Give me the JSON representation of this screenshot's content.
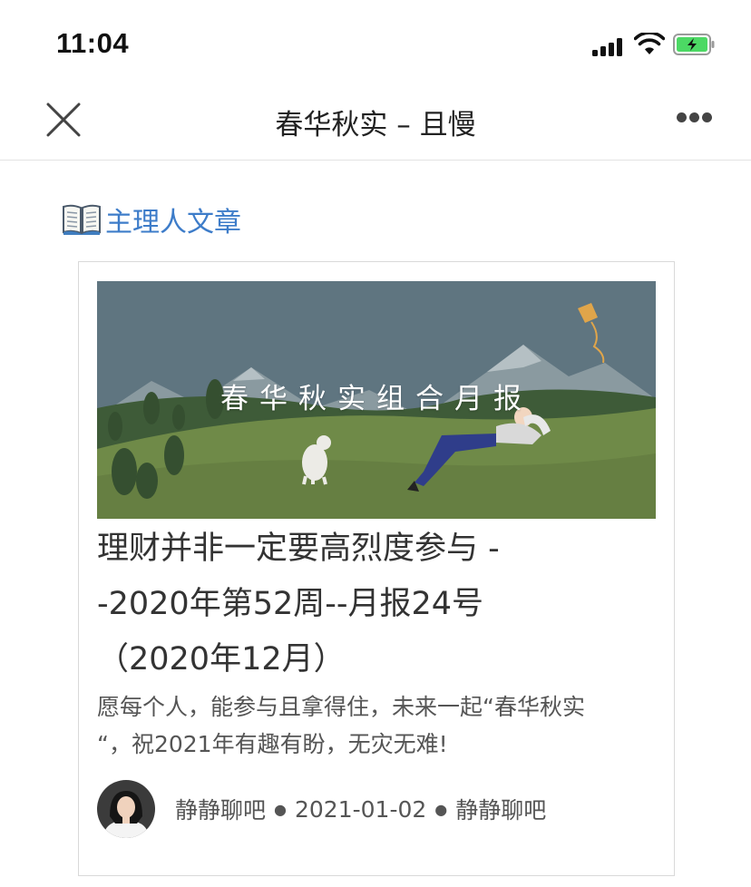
{
  "status_bar": {
    "time": "11:04"
  },
  "nav": {
    "title": "春华秋实 – 且慢"
  },
  "section": {
    "icon": "open-book-icon",
    "label": "主理人文章"
  },
  "article": {
    "banner_text": "春华秋实组合月报",
    "title_line1": "理财并非一定要高烈度参与 -",
    "title_line2": "-2020年第52周--月报24号",
    "title_line3": "（2020年12月）",
    "description_line1": "愿每个人，能参与且拿得住，未来一起“春华秋实",
    "description_line2": "“，祝2021年有趣有盼，无灾无难!",
    "author": "静静聊吧",
    "date": "2021-01-02",
    "source": "静静聊吧"
  },
  "colors": {
    "link_blue": "#3d7cc9",
    "battery_green": "#4cd964",
    "banner_sky": "#5f7580",
    "banner_grass": "#6f8a48"
  }
}
